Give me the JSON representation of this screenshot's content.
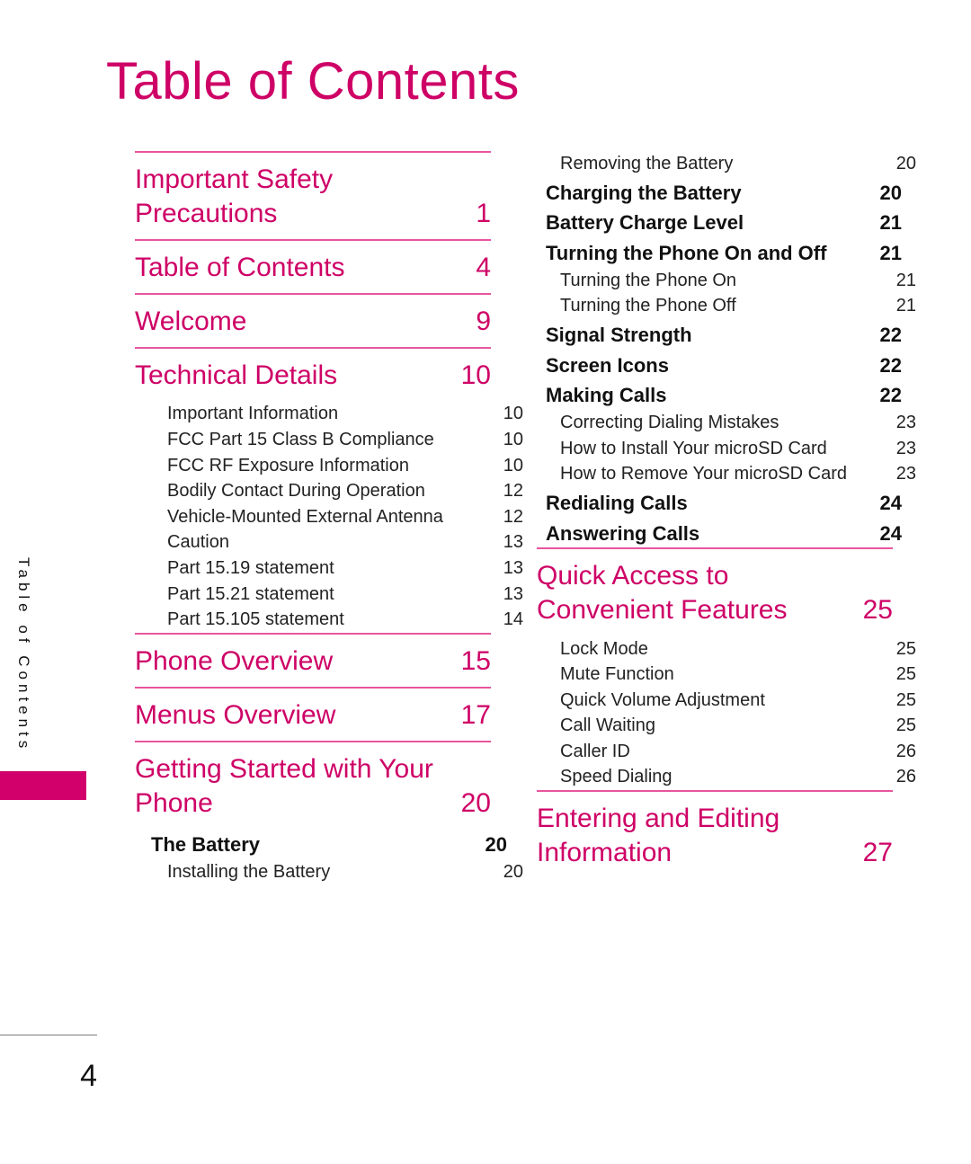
{
  "page": {
    "title": "Table of Contents",
    "folio": "4",
    "side_tab_label": "Table of Contents",
    "accent_color": "#CE0066",
    "rule_color": "#E8559E",
    "tab_block_color": "#D1006B"
  },
  "columns": {
    "left": [
      {
        "rule_above": true,
        "entries": [
          {
            "level": 1,
            "label": "Important Safety Precautions",
            "page": "1"
          }
        ]
      },
      {
        "rule_above": true,
        "entries": [
          {
            "level": 1,
            "label": "Table of Contents",
            "page": "4"
          }
        ]
      },
      {
        "rule_above": true,
        "entries": [
          {
            "level": 1,
            "label": "Welcome",
            "page": "9"
          }
        ]
      },
      {
        "rule_above": true,
        "entries": [
          {
            "level": 1,
            "label": "Technical Details",
            "page": "10"
          },
          {
            "level": 3,
            "label": "Important Information",
            "page": "10"
          },
          {
            "level": 3,
            "label": "FCC Part 15 Class B Compliance",
            "page": "10"
          },
          {
            "level": 3,
            "label": "FCC RF Exposure Information",
            "page": "10"
          },
          {
            "level": 3,
            "label": "Bodily Contact During Operation",
            "page": "12"
          },
          {
            "level": 3,
            "label": "Vehicle-Mounted External Antenna",
            "page": "12"
          },
          {
            "level": 3,
            "label": "Caution",
            "page": "13"
          },
          {
            "level": 3,
            "label": "Part 15.19 statement",
            "page": "13"
          },
          {
            "level": 3,
            "label": "Part 15.21 statement",
            "page": "13"
          },
          {
            "level": 3,
            "label": "Part 15.105 statement",
            "page": "14"
          }
        ]
      },
      {
        "rule_above": true,
        "entries": [
          {
            "level": 1,
            "label": "Phone Overview",
            "page": "15"
          }
        ]
      },
      {
        "rule_above": true,
        "entries": [
          {
            "level": 1,
            "label": "Menus Overview",
            "page": "17"
          }
        ]
      },
      {
        "rule_above": true,
        "entries": [
          {
            "level": 1,
            "label": "Getting Started with Your Phone",
            "page": "20"
          },
          {
            "level": 2,
            "label": "The Battery",
            "page": "20"
          },
          {
            "level": 3,
            "label": "Installing the Battery",
            "page": "20"
          }
        ]
      }
    ],
    "right": [
      {
        "rule_above": false,
        "entries": [
          {
            "level": 3,
            "label": "Removing the Battery",
            "page": "20"
          },
          {
            "level": 2,
            "label": "Charging the Battery",
            "page": "20"
          },
          {
            "level": 2,
            "label": "Battery Charge Level",
            "page": "21"
          },
          {
            "level": 2,
            "label": "Turning the Phone On and Off",
            "page": "21"
          },
          {
            "level": 3,
            "label": "Turning the Phone On",
            "page": "21"
          },
          {
            "level": 3,
            "label": "Turning the Phone Off",
            "page": "21"
          },
          {
            "level": 2,
            "label": "Signal Strength",
            "page": "22"
          },
          {
            "level": 2,
            "label": "Screen Icons",
            "page": "22"
          },
          {
            "level": 2,
            "label": "Making Calls",
            "page": "22"
          },
          {
            "level": 3,
            "label": "Correcting Dialing Mistakes",
            "page": "23"
          },
          {
            "level": 3,
            "label": "How to Install Your microSD Card",
            "page": "23"
          },
          {
            "level": 3,
            "label": "How to Remove Your microSD Card",
            "page": "23"
          },
          {
            "level": 2,
            "label": "Redialing Calls",
            "page": "24"
          },
          {
            "level": 2,
            "label": "Answering Calls",
            "page": "24"
          }
        ]
      },
      {
        "rule_above": true,
        "entries": [
          {
            "level": 1,
            "label": "Quick Access to Convenient Features",
            "page": "25"
          },
          {
            "level": 3,
            "label": "Lock Mode",
            "page": "25"
          },
          {
            "level": 3,
            "label": "Mute Function",
            "page": "25"
          },
          {
            "level": 3,
            "label": "Quick Volume Adjustment",
            "page": "25"
          },
          {
            "level": 3,
            "label": "Call Waiting",
            "page": "25"
          },
          {
            "level": 3,
            "label": "Caller ID",
            "page": "26"
          },
          {
            "level": 3,
            "label": "Speed Dialing",
            "page": "26"
          }
        ]
      },
      {
        "rule_above": true,
        "entries": [
          {
            "level": 1,
            "label": "Entering and Editing Information",
            "page": "27"
          }
        ]
      }
    ]
  }
}
